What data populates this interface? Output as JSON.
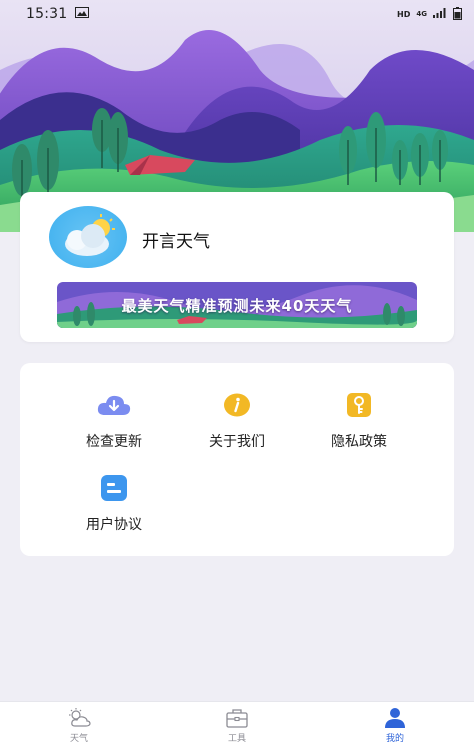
{
  "status_bar": {
    "time": "15:31",
    "hd": "HD",
    "network": "4G"
  },
  "app_card": {
    "app_name": "开言天气",
    "banner_text": "最美天气精准预测未来40天天气"
  },
  "menu": {
    "items": [
      {
        "label": "检查更新",
        "icon": "cloud-download-icon",
        "color": "#7b8cf0"
      },
      {
        "label": "关于我们",
        "icon": "info-icon",
        "color": "#f2b825"
      },
      {
        "label": "隐私政策",
        "icon": "key-icon",
        "color": "#f2b825"
      },
      {
        "label": "用户协议",
        "icon": "document-icon",
        "color": "#3d96ee"
      }
    ]
  },
  "bottom_nav": {
    "tabs": [
      {
        "label": "天气",
        "icon": "weather-icon"
      },
      {
        "label": "工具",
        "icon": "toolbox-icon"
      },
      {
        "label": "我的",
        "icon": "user-icon",
        "active": true
      }
    ]
  },
  "colors": {
    "accent": "#2f64d8",
    "background": "#efeef5"
  }
}
